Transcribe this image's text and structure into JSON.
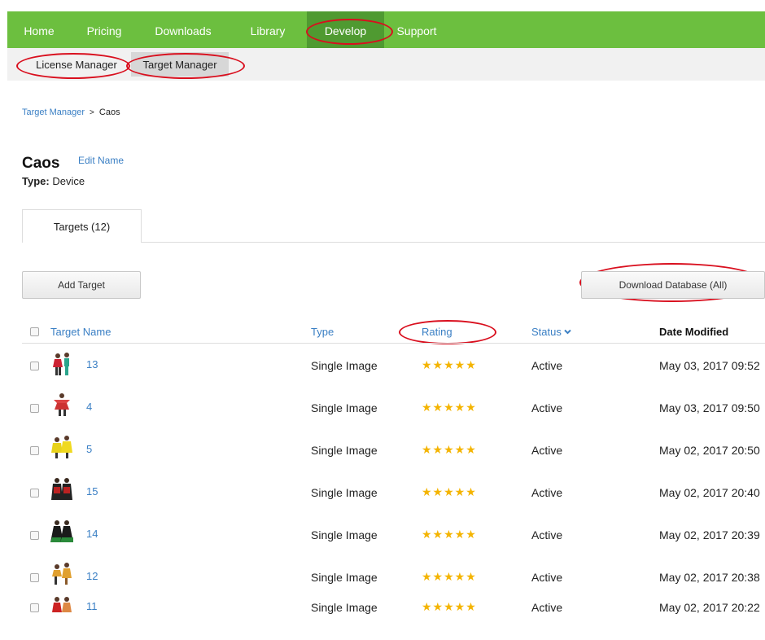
{
  "topnav": {
    "items": [
      {
        "label": "Home"
      },
      {
        "label": "Pricing"
      },
      {
        "label": "Downloads"
      },
      {
        "label": "Library"
      },
      {
        "label": "Develop"
      },
      {
        "label": "Support"
      }
    ],
    "active": "Develop"
  },
  "subnav": {
    "items": [
      {
        "label": "License Manager"
      },
      {
        "label": "Target Manager"
      }
    ],
    "active": "Target Manager"
  },
  "breadcrumb": {
    "parent": "Target Manager",
    "separator": ">",
    "current": "Caos"
  },
  "database": {
    "name": "Caos",
    "edit_label": "Edit Name",
    "type_label": "Type:",
    "type_value": "Device"
  },
  "tabs": [
    {
      "label": "Targets (12)"
    }
  ],
  "actions": {
    "add_target": "Add Target",
    "download_database": "Download Database (All)"
  },
  "table": {
    "headers": {
      "name": "Target Name",
      "type": "Type",
      "rating": "Rating",
      "status": "Status",
      "date": "Date Modified"
    },
    "status_sort_icon": "chevron-down-icon",
    "rows": [
      {
        "name": "13",
        "type": "Single Image",
        "rating": 5,
        "status": "Active",
        "date": "May 03, 2017 09:52"
      },
      {
        "name": "4",
        "type": "Single Image",
        "rating": 5,
        "status": "Active",
        "date": "May 03, 2017 09:50"
      },
      {
        "name": "5",
        "type": "Single Image",
        "rating": 5,
        "status": "Active",
        "date": "May 02, 2017 20:50"
      },
      {
        "name": "15",
        "type": "Single Image",
        "rating": 5,
        "status": "Active",
        "date": "May 02, 2017 20:40"
      },
      {
        "name": "14",
        "type": "Single Image",
        "rating": 5,
        "status": "Active",
        "date": "May 02, 2017 20:39"
      },
      {
        "name": "12",
        "type": "Single Image",
        "rating": 5,
        "status": "Active",
        "date": "May 02, 2017 20:38"
      },
      {
        "name": "11",
        "type": "Single Image",
        "rating": 5,
        "status": "Active",
        "date": "May 02, 2017 20:22"
      }
    ]
  },
  "colors": {
    "nav_green": "#6cbf3f",
    "nav_active": "#4f9a31",
    "link_blue": "#3a7fc4",
    "star_gold": "#f4b400",
    "annotation_red": "#d90f1e"
  }
}
